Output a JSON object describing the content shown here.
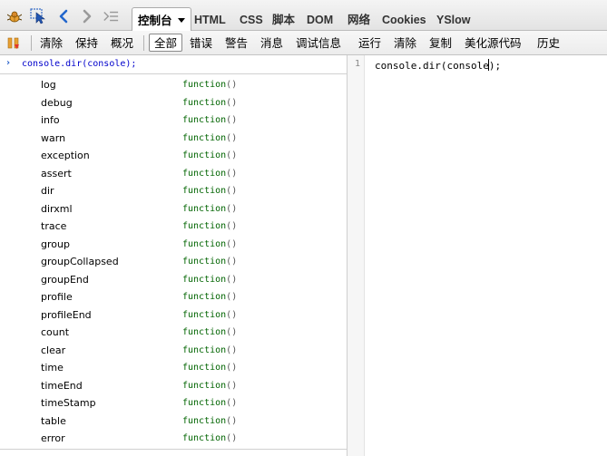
{
  "tabs": [
    {
      "label": "控制台",
      "active": true,
      "has_dropdown": true
    },
    {
      "label": "HTML"
    },
    {
      "label": "CSS"
    },
    {
      "label": "脚本"
    },
    {
      "label": "DOM"
    },
    {
      "label": "网络"
    },
    {
      "label": "Cookies"
    },
    {
      "label": "YSlow"
    }
  ],
  "toolbar": {
    "clear": "清除",
    "persist": "保持",
    "profile": "概况",
    "all": "全部",
    "errors": "错误",
    "warnings": "警告",
    "info": "消息",
    "debug": "调试信息",
    "run": "运行",
    "clear2": "清除",
    "copy": "复制",
    "prettify": "美化源代码",
    "history": "历史"
  },
  "console": {
    "prompt": "›",
    "command": "console.dir(console);"
  },
  "properties": [
    {
      "name": "log",
      "value": "function"
    },
    {
      "name": "debug",
      "value": "function"
    },
    {
      "name": "info",
      "value": "function"
    },
    {
      "name": "warn",
      "value": "function"
    },
    {
      "name": "exception",
      "value": "function"
    },
    {
      "name": "assert",
      "value": "function"
    },
    {
      "name": "dir",
      "value": "function"
    },
    {
      "name": "dirxml",
      "value": "function"
    },
    {
      "name": "trace",
      "value": "function"
    },
    {
      "name": "group",
      "value": "function"
    },
    {
      "name": "groupCollapsed",
      "value": "function"
    },
    {
      "name": "groupEnd",
      "value": "function"
    },
    {
      "name": "profile",
      "value": "function"
    },
    {
      "name": "profileEnd",
      "value": "function"
    },
    {
      "name": "count",
      "value": "function"
    },
    {
      "name": "clear",
      "value": "function"
    },
    {
      "name": "time",
      "value": "function"
    },
    {
      "name": "timeEnd",
      "value": "function"
    },
    {
      "name": "timeStamp",
      "value": "function"
    },
    {
      "name": "table",
      "value": "function"
    },
    {
      "name": "error",
      "value": "function"
    }
  ],
  "editor": {
    "line_number": "1",
    "code_before_caret": "console.dir(console",
    "code_after_caret": ");"
  },
  "icons": [
    "firebug-icon",
    "inspect-icon",
    "back-arrow-icon",
    "forward-arrow-icon",
    "command-line-icon",
    "dropdown-arrow-icon",
    "pause-icon"
  ]
}
